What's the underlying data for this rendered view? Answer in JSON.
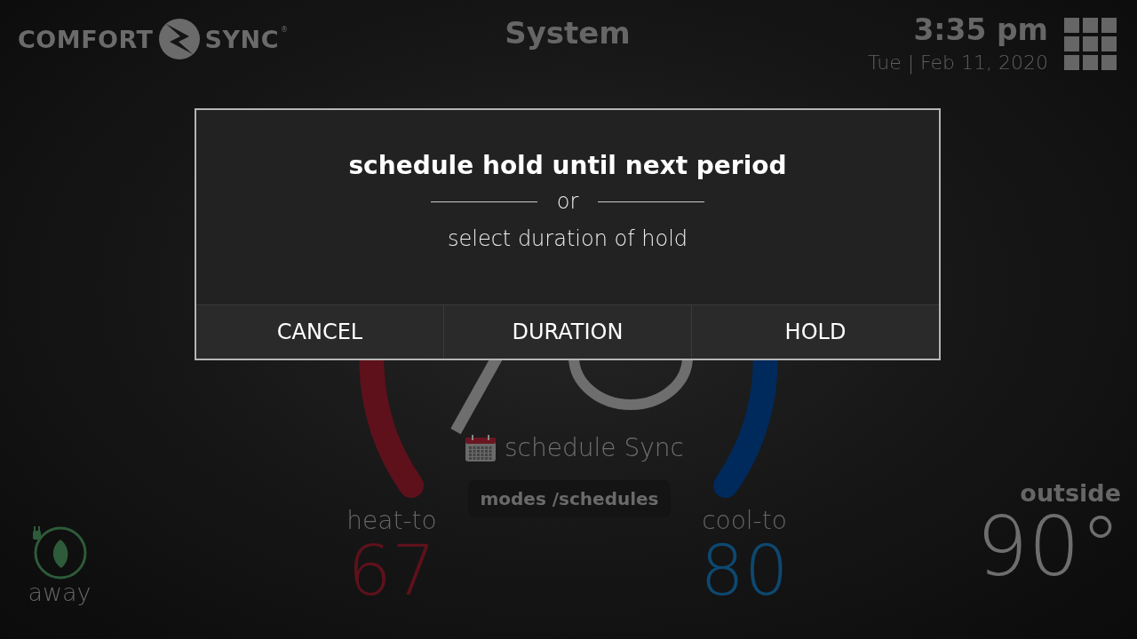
{
  "header": {
    "logo": {
      "left": "COMFORT",
      "right": "SYNC",
      "mark": "®"
    },
    "title": "System",
    "time": "3:35 pm",
    "date": "Tue | Feb 11, 2020"
  },
  "dial": {
    "schedule_label": "schedule Sync",
    "modes_button": "modes /schedules",
    "heat": {
      "label": "heat-to",
      "value": "67"
    },
    "cool": {
      "label": "cool-to",
      "value": "80"
    }
  },
  "away": {
    "label": "away"
  },
  "outside": {
    "label": "outside",
    "value": "90°"
  },
  "dialog": {
    "title": "schedule hold until next period",
    "separator": "or",
    "subtitle": "select duration of hold",
    "buttons": [
      "CANCEL",
      "DURATION",
      "HOLD"
    ]
  }
}
